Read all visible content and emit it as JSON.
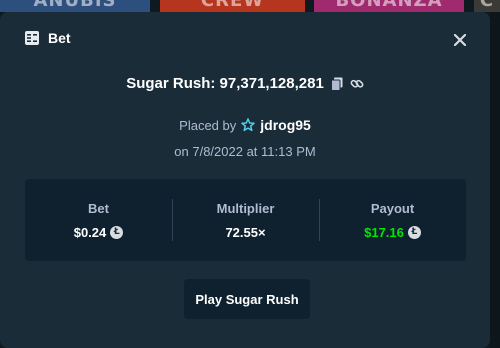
{
  "background_tiles": [
    "ANUBIS",
    "CREW",
    "BONANZA",
    "C"
  ],
  "modal": {
    "title": "Bet",
    "icon": "bet-slip-icon",
    "close_icon": "close-icon"
  },
  "game": {
    "name_label": "Sugar Rush: 97,371,128,281",
    "copy_icon": "copy-icon",
    "link_icon": "link-icon"
  },
  "placed": {
    "prefix": "Placed by",
    "badge_icon": "vip-star-icon",
    "username": "jdrog95",
    "date": "on 7/8/2022 at 11:13 PM"
  },
  "stats": {
    "bet_label": "Bet",
    "bet_value": "$0.24",
    "multiplier_label": "Multiplier",
    "multiplier_value": "72.55×",
    "payout_label": "Payout",
    "payout_value": "$17.16",
    "currency_icon": "litecoin-icon"
  },
  "action": {
    "play_label": "Play Sugar Rush"
  },
  "colors": {
    "modal_bg": "#1a2c38",
    "panel_bg": "#0f212e",
    "muted_text": "#b1bad3",
    "payout_green": "#00e701",
    "badge_teal": "#4fd1e8"
  }
}
